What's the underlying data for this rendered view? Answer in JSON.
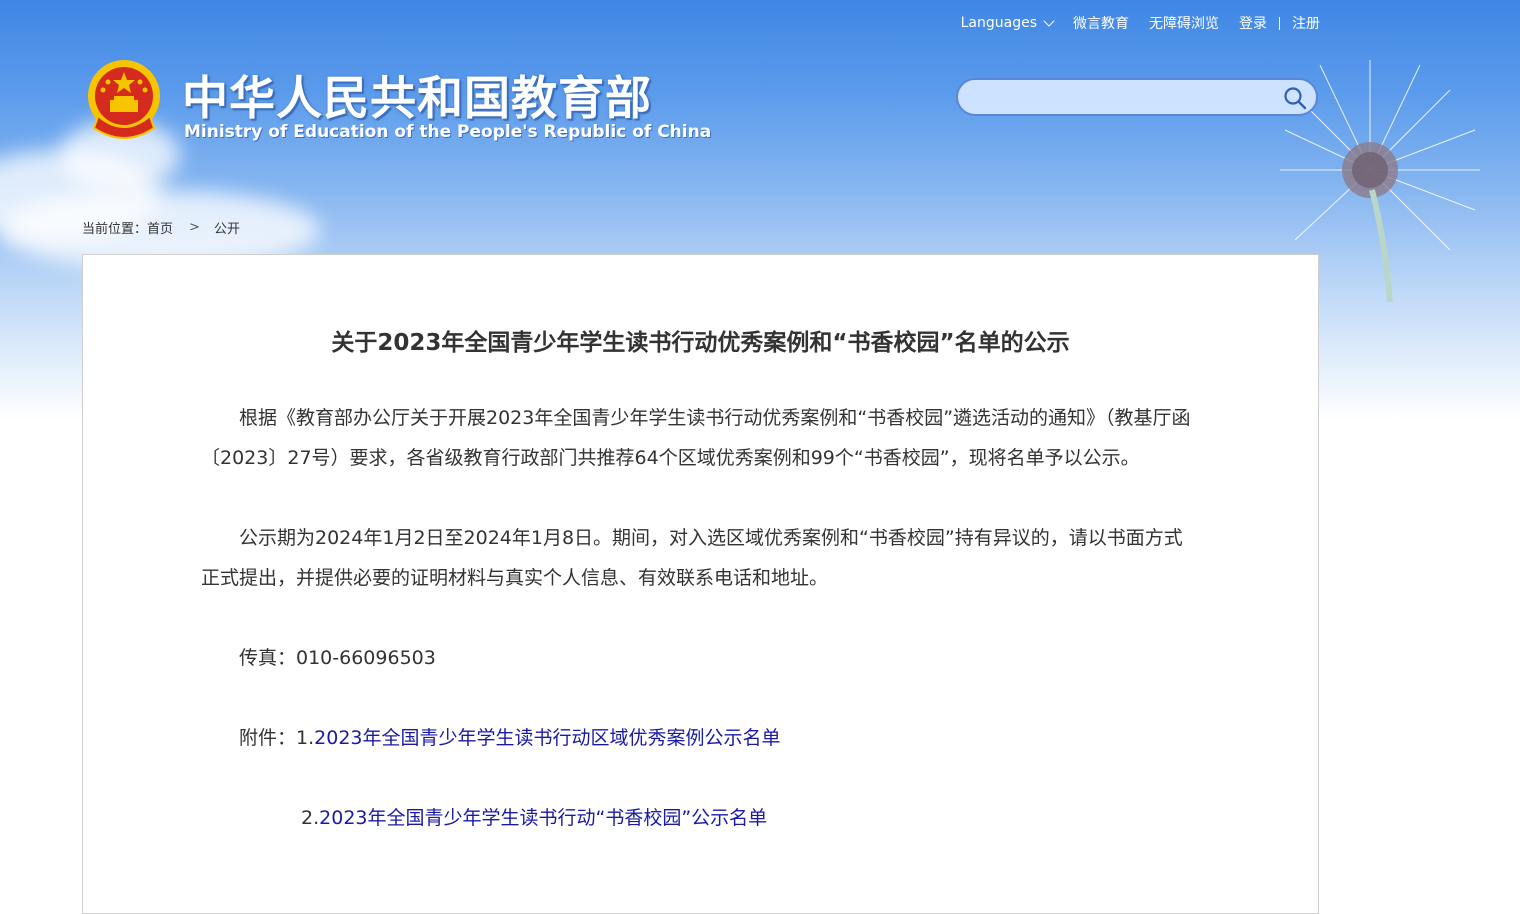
{
  "topbar": {
    "languages": "Languages",
    "weiyan": "微言教育",
    "accessible": "无障碍浏览",
    "login": "登录",
    "register": "注册"
  },
  "header": {
    "title_cn": "中华人民共和国教育部",
    "title_en": "Ministry of Education of the People's Republic of China"
  },
  "search": {
    "placeholder": "",
    "value": ""
  },
  "breadcrumb": {
    "label": "当前位置：",
    "home": "首页",
    "current": "公开"
  },
  "article": {
    "title": "关于2023年全国青少年学生读书行动优秀案例和“书香校园”名单的公示",
    "para1": "根据《教育部办公厅关于开展2023年全国青少年学生读书行动优秀案例和“书香校园”遴选活动的通知》（教基厅函〔2023〕27号）要求，各省级教育行政部门共推荐64个区域优秀案例和99个“书香校园”，现将名单予以公示。",
    "para2": "公示期为2024年1月2日至2024年1月8日。期间，对入选区域优秀案例和“书香校园”持有异议的，请以书面方式正式提出，并提供必要的证明材料与真实个人信息、有效联系电话和地址。",
    "fax": "传真：010-66096503",
    "attach_label": "附件：",
    "attach1_num": "1.",
    "attach1": "2023年全国青少年学生读书行动区域优秀案例公示名单",
    "attach2_num": "2.",
    "attach2": "2023年全国青少年学生读书行动“书香校园”公示名单"
  },
  "colors": {
    "sky_top": "#3f86e4",
    "link": "#1a1aa6",
    "text": "#333333",
    "emblem_red": "#d52b1e",
    "emblem_gold": "#f7c400"
  }
}
